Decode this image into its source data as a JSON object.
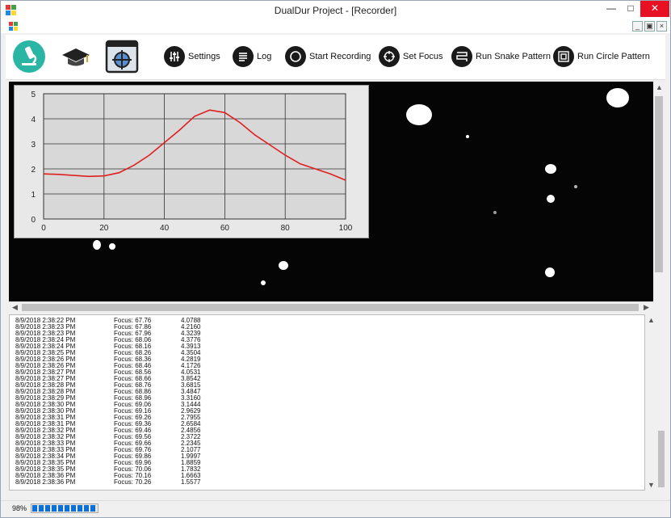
{
  "window": {
    "title": "DualDur Project - [Recorder]"
  },
  "toolbar": {
    "buttons": [
      {
        "label": "Settings",
        "icon": "sliders-icon"
      },
      {
        "label": "Log",
        "icon": "list-icon"
      },
      {
        "label": "Start Recording",
        "icon": "record-icon"
      },
      {
        "label": "Set Focus",
        "icon": "focus-icon"
      },
      {
        "label": "Run Snake Pattern",
        "icon": "snake-pattern-icon"
      },
      {
        "label": "Run Circle Pattern",
        "icon": "circle-pattern-icon"
      }
    ],
    "big_icons": [
      "microscope-icon",
      "graduation-cap-icon",
      "target-window-icon"
    ]
  },
  "chart_data": {
    "type": "line",
    "title": "",
    "xlabel": "",
    "ylabel": "",
    "xlim": [
      0,
      100
    ],
    "ylim": [
      0,
      5
    ],
    "xticks": [
      "0",
      "20",
      "40",
      "60",
      "80",
      "100"
    ],
    "yticks": [
      "0",
      "1",
      "2",
      "3",
      "4",
      "5"
    ],
    "grid": true,
    "series": [
      {
        "color": "#e02020",
        "x": [
          0,
          5,
          10,
          15,
          20,
          25,
          30,
          35,
          40,
          45,
          50,
          55,
          60,
          65,
          70,
          75,
          80,
          85,
          90,
          95,
          100
        ],
        "y": [
          1.8,
          1.78,
          1.74,
          1.7,
          1.72,
          1.85,
          2.15,
          2.55,
          3.05,
          3.55,
          4.1,
          4.35,
          4.25,
          3.85,
          3.35,
          2.95,
          2.55,
          2.2,
          2.0,
          1.8,
          1.55
        ]
      }
    ]
  },
  "log": {
    "rows": [
      [
        "8/9/2018 2:38:22 PM",
        "Focus: 67.76",
        "4.0788"
      ],
      [
        "8/9/2018 2:38:23 PM",
        "Focus: 67.86",
        "4.2160"
      ],
      [
        "8/9/2018 2:38:23 PM",
        "Focus: 67.96",
        "4.3239"
      ],
      [
        "8/9/2018 2:38:24 PM",
        "Focus: 68.06",
        "4.3776"
      ],
      [
        "8/9/2018 2:38:24 PM",
        "Focus: 68.16",
        "4.3913"
      ],
      [
        "8/9/2018 2:38:25 PM",
        "Focus: 68.26",
        "4.3504"
      ],
      [
        "8/9/2018 2:38:26 PM",
        "Focus: 68.36",
        "4.2819"
      ],
      [
        "8/9/2018 2:38:26 PM",
        "Focus: 68.46",
        "4.1726"
      ],
      [
        "8/9/2018 2:38:27 PM",
        "Focus: 68.56",
        "4.0531"
      ],
      [
        "8/9/2018 2:38:27 PM",
        "Focus: 68.66",
        "3.8542"
      ],
      [
        "8/9/2018 2:38:28 PM",
        "Focus: 68.76",
        "3.6815"
      ],
      [
        "8/9/2018 2:38:28 PM",
        "Focus: 68.86",
        "3.4847"
      ],
      [
        "8/9/2018 2:38:29 PM",
        "Focus: 68.96",
        "3.3160"
      ],
      [
        "8/9/2018 2:38:30 PM",
        "Focus: 69.06",
        "3.1444"
      ],
      [
        "8/9/2018 2:38:30 PM",
        "Focus: 69.16",
        "2.9629"
      ],
      [
        "8/9/2018 2:38:31 PM",
        "Focus: 69.26",
        "2.7955"
      ],
      [
        "8/9/2018 2:38:31 PM",
        "Focus: 69.36",
        "2.6584"
      ],
      [
        "8/9/2018 2:38:32 PM",
        "Focus: 69.46",
        "2.4856"
      ],
      [
        "8/9/2018 2:38:32 PM",
        "Focus: 69.56",
        "2.3722"
      ],
      [
        "8/9/2018 2:38:33 PM",
        "Focus: 69.66",
        "2.2345"
      ],
      [
        "8/9/2018 2:38:33 PM",
        "Focus: 69.76",
        "2.1077"
      ],
      [
        "8/9/2018 2:38:34 PM",
        "Focus: 69.86",
        "1.9997"
      ],
      [
        "8/9/2018 2:38:35 PM",
        "Focus: 69.96",
        "1.8859"
      ],
      [
        "8/9/2018 2:38:35 PM",
        "Focus: 70.06",
        "1.7832"
      ],
      [
        "8/9/2018 2:38:36 PM",
        "Focus: 70.16",
        "1.6663"
      ],
      [
        "8/9/2018 2:38:36 PM",
        "Focus: 70.26",
        "1.5577"
      ]
    ]
  },
  "status": {
    "progress_text": "98%",
    "progress_fraction": 0.98
  }
}
